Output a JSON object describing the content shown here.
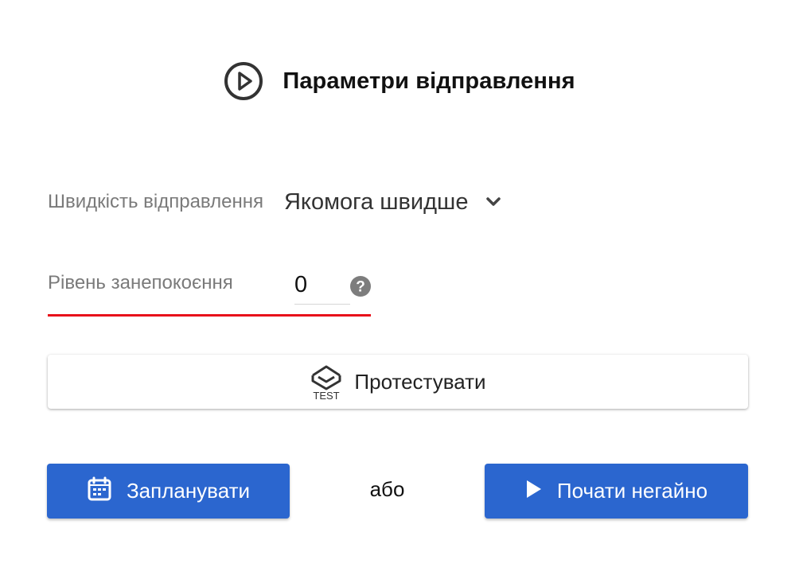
{
  "header": {
    "title": "Параметри відправлення",
    "icon": "play-circle-icon"
  },
  "speed": {
    "label": "Швидкість відправлення",
    "value": "Якомога швидше",
    "icon": "chevron-down-icon"
  },
  "level": {
    "label": "Рівень занепокоєння",
    "value": "0",
    "help_icon": "question-circle-icon",
    "underline_color": "#e8101a"
  },
  "test_button": {
    "label": "Протестувати",
    "icon_text": "TEST",
    "icon": "test-envelope-icon"
  },
  "schedule_button": {
    "label": "Запланувати",
    "icon": "calendar-icon"
  },
  "or_text": "або",
  "start_button": {
    "label": "Почати негайно",
    "icon": "play-icon"
  },
  "colors": {
    "primary": "#2b66cf",
    "error": "#e8101a",
    "label": "#7a7a7a"
  }
}
